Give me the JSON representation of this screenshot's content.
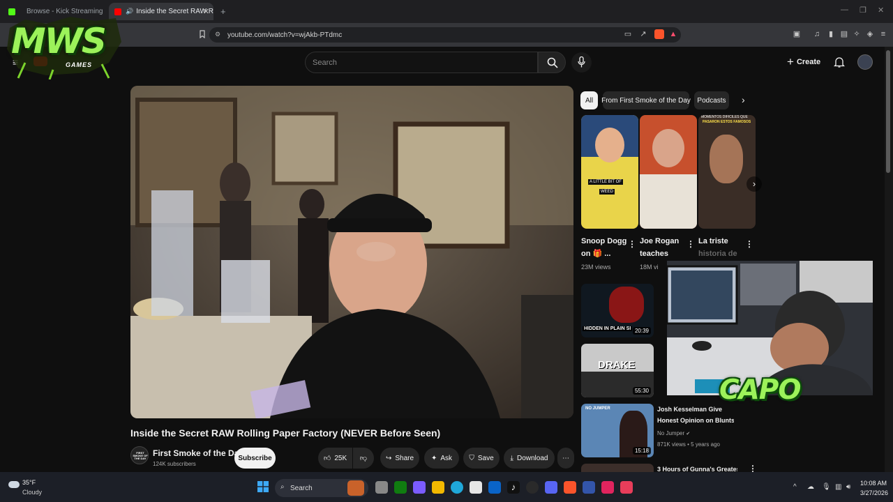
{
  "browser": {
    "tabs": [
      {
        "label": "Browse - Kick Streaming"
      },
      {
        "label": "Inside the Secret RAW Rolling"
      }
    ],
    "url": "youtube.com/watch?v=wjAkb-PTdmc"
  },
  "youtube": {
    "search_placeholder": "Search",
    "create_label": "Create",
    "video": {
      "title": "Inside the Secret RAW Rolling Paper Factory (NEVER Before Seen)",
      "channel_name": "First Smoke of the Day",
      "channel_avatar_text": "FIRST SMOKE OF THE DAY",
      "subscribers": "124K subscribers",
      "subscribe_label": "Subscribe",
      "likes": "25K",
      "share_label": "Share",
      "ask_label": "Ask",
      "save_label": "Save",
      "download_label": "Download"
    },
    "chips": [
      {
        "label": "All",
        "selected": true
      },
      {
        "label": "From First Smoke of the Day",
        "selected": false
      },
      {
        "label": "Podcasts",
        "selected": false
      }
    ],
    "shorts": [
      {
        "title_line1": "Snoop Dogg",
        "title_line2": "on 🎁 ...",
        "views": "23M views",
        "caption": "A LITTLE BIT OF",
        "caption2": "WEED"
      },
      {
        "title_line1": "Joe Rogan",
        "title_line2": "teaches",
        "views": "18M vi"
      },
      {
        "title_line1": "La triste",
        "title_line2": "historia de",
        "views": "",
        "caption": "MOMENTOS DIFICILES QUE",
        "caption2": "PASARON ESTOS FAMOSOS"
      }
    ],
    "videos": [
      {
        "thumb_text": "HIDDEN IN PLAIN SI",
        "duration": "20:39"
      },
      {
        "thumb_text": "DRAKE",
        "duration": "55:30"
      },
      {
        "title_line1": "Josh Kesselman Give",
        "title_line2": "Honest Opinion on Blunts ...",
        "channel": "No Jumper",
        "meta": "871K views • 5 years ago",
        "duration": "15:18",
        "thumb_text": "NO JUMPER"
      },
      {
        "title_line1": "3 Hours of Gunna's Greatest"
      }
    ]
  },
  "overlays": {
    "logo_text": "MWS",
    "logo_sub": "GAMES",
    "cam_label": "CAPO"
  },
  "taskbar": {
    "weather_temp": "35°F",
    "weather_desc": "Cloudy",
    "search_label": "Search",
    "time": "10:08 AM",
    "date": "3/27/2026"
  },
  "colors": {
    "youtube_red": "#ff0000",
    "background": "#0f0f0f",
    "kick_green": "#53fc18",
    "capo_green": "#9cf25a"
  }
}
